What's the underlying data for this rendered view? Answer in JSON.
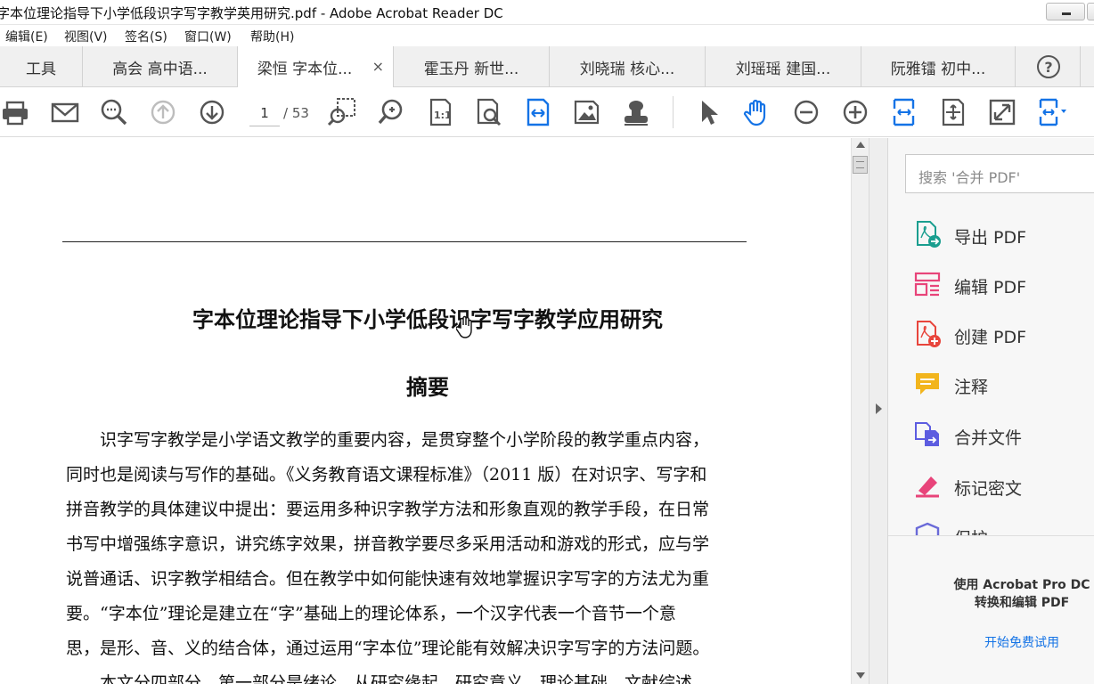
{
  "window": {
    "title": "字本位理论指导下小学低段识字写字教学英用研究.pdf - Adobe Acrobat Reader DC"
  },
  "menu": [
    "编辑(E)",
    "视图(V)",
    "签名(S)",
    "窗口(W)",
    "帮助(H)"
  ],
  "tabs": {
    "tools_label": "工具",
    "docs": [
      {
        "label": "高会 高中语..."
      },
      {
        "label": "梁恒 字本位...",
        "active": true,
        "close": "×"
      },
      {
        "label": "霍玉丹 新世..."
      },
      {
        "label": "刘晓瑞 核心..."
      },
      {
        "label": "刘瑶瑶 建国..."
      },
      {
        "label": "阮雅镭 初中..."
      }
    ],
    "help": "?"
  },
  "toolbar": {
    "current_page": "1",
    "total_pages": "/ 53",
    "icons": [
      "print-icon",
      "email-icon",
      "zoom-search-icon",
      "page-up-icon",
      "page-down-icon",
      "marquee-zoom-icon",
      "find-icon",
      "actual-size-icon",
      "page-find-icon",
      "fit-width-icon",
      "image-icon",
      "stamp-icon",
      "select-arrow-icon",
      "hand-tool-icon",
      "zoom-out-icon",
      "zoom-in-icon",
      "fit-page-icon",
      "rotate-icon",
      "fullscreen-icon",
      "page-display-icon"
    ]
  },
  "document": {
    "title": "字本位理论指导下小学低段识字写字教学应用研究",
    "abstract_heading": "摘要",
    "lines": [
      "　　识字写字教学是小学语文教学的重要内容，是贯穿整个小学阶段的教学重点内容，",
      "同时也是阅读与写作的基础。《义务教育语文课程标准》（2011 版）在对识字、写字和",
      "拼音教学的具体建议中提出：要运用多种识字教学方法和形象直观的教学手段，在日常",
      "书写中增强练字意识，讲究练字效果，拼音教学要尽多采用活动和游戏的形式，应与学",
      "说普通话、识字教学相结合。但在教学中如何能快速有效地掌握识字写字的方法尤为重",
      "要。“字本位”理论是建立在“字”基础上的理论体系，一个汉字代表一个音节一个意",
      "思，是形、音、义的结合体，通过运用“字本位”理论能有效解决识字写字的方法问题。",
      "　　本文分四部分　第一部分是绪论　从研究缘起　研究意义　理论基础　文献综述"
    ]
  },
  "right_panel": {
    "search_placeholder": "搜索 '合并 PDF'",
    "tools": [
      {
        "label": "导出 PDF",
        "icon": "export-pdf-icon",
        "color": "#1a9e8f"
      },
      {
        "label": "编辑 PDF",
        "icon": "edit-pdf-icon",
        "color": "#e8447a"
      },
      {
        "label": "创建 PDF",
        "icon": "create-pdf-icon",
        "color": "#e8453c"
      },
      {
        "label": "注释",
        "icon": "comment-icon",
        "color": "#f2b51d"
      },
      {
        "label": "合并文件",
        "icon": "combine-files-icon",
        "color": "#5c5ce0"
      },
      {
        "label": "标记密文",
        "icon": "redact-icon",
        "color": "#e8447a"
      },
      {
        "label": "保护",
        "icon": "protect-icon",
        "color": "#6a6ad8"
      }
    ],
    "promo_line1": "使用 Acrobat Pro DC",
    "promo_line2": "转换和编辑 PDF",
    "trial_link": "开始免费试用"
  }
}
